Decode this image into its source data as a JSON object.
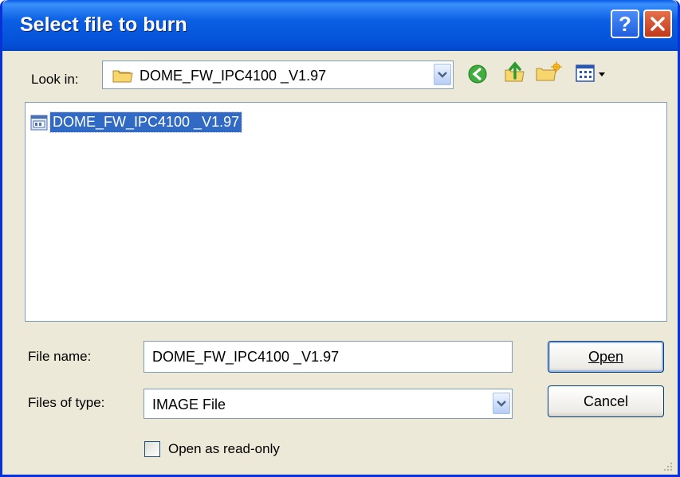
{
  "dialog": {
    "title": "Select file to burn",
    "help_glyph": "?",
    "close_glyph": "X"
  },
  "look_in": {
    "label": "Look in:",
    "value": "DOME_FW_IPC4100 _V1.97",
    "folder_icon": "folder-icon"
  },
  "toolbar": {
    "back_icon": "back-arrow-icon",
    "up_icon": "up-folder-icon",
    "new_folder_icon": "new-folder-icon",
    "view_menu_icon": "view-menu-icon"
  },
  "files": [
    {
      "name": "DOME_FW_IPC4100 _V1.97",
      "icon": "file-icon",
      "selected": true
    }
  ],
  "file_name": {
    "label": "File name:",
    "value": "DOME_FW_IPC4100 _V1.97"
  },
  "file_type": {
    "label": "Files of type:",
    "value": "IMAGE File"
  },
  "buttons": {
    "open": "Open",
    "cancel": "Cancel"
  },
  "readonly": {
    "label": "Open as read-only",
    "checked": false
  },
  "colors": {
    "titlebar": "#0a5fe3",
    "selection": "#316ac5",
    "dialog_bg": "#ece9d8"
  }
}
